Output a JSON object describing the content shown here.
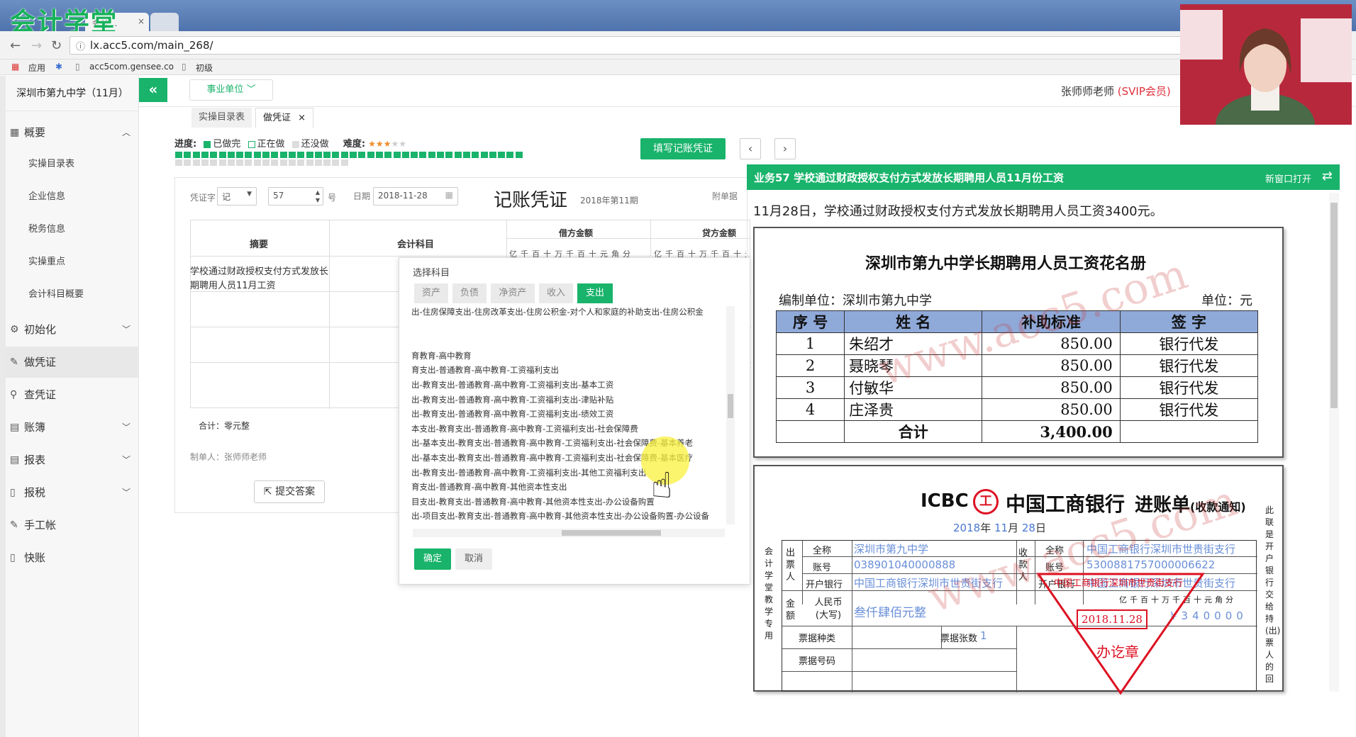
{
  "browser": {
    "logo_text": "会计学堂",
    "tab_label": "会计...",
    "url": "lx.acc5.com/main_268/",
    "bookmarks": [
      "应用",
      "acc5com.gensee.co",
      "初级"
    ]
  },
  "app": {
    "unit_select": "事业单位",
    "teacher": "张师师老师",
    "teacher_badge": "(SVIP会员)"
  },
  "sidebar": {
    "org": "深圳市第九中学（11月）",
    "sections": [
      {
        "label": "概要",
        "icon": "grid-icon"
      },
      {
        "label": "初始化",
        "icon": "gear-icon"
      },
      {
        "label": "做凭证",
        "icon": "pen-icon"
      },
      {
        "label": "查凭证",
        "icon": "search-icon"
      },
      {
        "label": "账簿",
        "icon": "book-icon"
      },
      {
        "label": "报表",
        "icon": "table-icon"
      },
      {
        "label": "报税",
        "icon": "doc-icon"
      },
      {
        "label": "手工帐",
        "icon": "pen-icon"
      },
      {
        "label": "快账",
        "icon": "doc-icon"
      }
    ],
    "sub_items": [
      "实操目录表",
      "企业信息",
      "税务信息",
      "实操重点",
      "会计科目概要"
    ]
  },
  "tabs": [
    "实操目录表",
    "做凭证"
  ],
  "progress": {
    "label": "进度:",
    "legend": [
      "已做完",
      "正在做",
      "还没做"
    ],
    "difficulty_label": "难度:",
    "difficulty": 3,
    "difficulty_max": 5,
    "done_cells": 36,
    "total_cells": 60
  },
  "toolbar": {
    "fill_voucher": "填写记账凭证",
    "prev": "‹",
    "next": "›"
  },
  "voucher": {
    "type_label": "凭证字",
    "type_value": "记",
    "number": "57",
    "number_suffix": "号",
    "date_label": "日期",
    "date_value": "2018-11-28",
    "title": "记账凭证",
    "period": "2018年第11期",
    "attach_label": "附单据",
    "col_summary": "摘要",
    "col_subject": "会计科目",
    "col_debit": "借方金额",
    "col_credit": "贷方金额",
    "digit_headers": "亿千百十万千百十元角分",
    "summary_text": "学校通过财政授权支付方式发放长期聘用人员11月工资",
    "total": "合计：零元整",
    "maker": "制单人：张师师老师",
    "submit": "提交答案"
  },
  "picker": {
    "title": "选择科目",
    "tabs": [
      "资产",
      "负债",
      "净资产",
      "收入",
      "支出"
    ],
    "active_tab": "支出",
    "rows": [
      "出-住房保障支出-住房改革支出-住房公积金-对个人和家庭的补助支出-住房公积金",
      "",
      "",
      "育教育-高中教育",
      "育支出-普通教育-高中教育-工资福利支出",
      "出-教育支出-普通教育-高中教育-工资福利支出-基本工资",
      "出-教育支出-普通教育-高中教育-工资福利支出-津贴补贴",
      "出-教育支出-普通教育-高中教育-工资福利支出-绩效工资",
      "本支出-教育支出-普通教育-高中教育-工资福利支出-社会保障费",
      "出-基本支出-教育支出-普通教育-高中教育-工资福利支出-社会保障费-基本养老",
      "出-基本支出-教育支出-普通教育-高中教育-工资福利支出-社会保障费-基本医疗",
      "出-教育支出-普通教育-高中教育-工资福利支出-其他工资福利支出",
      "育支出-普通教育-高中教育-其他资本性支出",
      "目支出-教育支出-普通教育-高中教育-其他资本性支出-办公设备购置",
      "出-项目支出-教育支出-普通教育-高中教育-其他资本性支出-办公设备购置-办公设备"
    ],
    "ok": "确定",
    "cancel": "取消"
  },
  "business": {
    "header": "业务57 学校通过财政授权支付方式发放长期聘用人员11月份工资",
    "new_window": "新窗口打开",
    "swap_icon": "⇄",
    "description": "11月28日，学校通过财政授权支付方式发放长期聘用人员工资3400元。"
  },
  "payroll": {
    "title": "深圳市第九中学长期聘用人员工资花名册",
    "unit_label": "编制单位：深圳市第九中学",
    "unit_right": "单位：元",
    "headers": [
      "序  号",
      "姓  名",
      "补助标准",
      "签  字"
    ],
    "rows": [
      [
        "1",
        "朱绍才",
        "850.00",
        "银行代发"
      ],
      [
        "2",
        "聂晓琴",
        "850.00",
        "银行代发"
      ],
      [
        "3",
        "付敏华",
        "850.00",
        "银行代发"
      ],
      [
        "4",
        "庄泽贵",
        "850.00",
        "银行代发"
      ]
    ],
    "total_label": "合计",
    "total_value": "3,400.00",
    "watermark": "www.acc5.com"
  },
  "bank": {
    "logo": "ICBC",
    "bank_name": "中国工商银行",
    "doc_title": "进账单",
    "doc_subtitle": "(收款通知)",
    "right_vertical": "此联是开户银行交给持(出)票人的回",
    "date_year": "2018",
    "date_month": "11",
    "date_day": "28",
    "date_sep_year": "年",
    "date_sep_month": "月",
    "date_sep_day": "日",
    "side_label": "会计学堂教学专用",
    "payer_label": "出票人",
    "payee_label": "收款人",
    "full_name": "全称",
    "account": "账号",
    "bank_label": "开户银行",
    "payer_name": "深圳市第九中学",
    "payer_account": "038901040000888",
    "payer_bank": "中国工商银行深圳市世贵街支行",
    "payee_name": "中国工商银行深圳市世贵街支行",
    "payee_account": "5300881757000006622",
    "payee_bank": "中国工商银行深圳市世贵街支行",
    "amount_label": "金额",
    "rmb_label": "人民币(大写)",
    "amount_words": "叁仟肆佰元整",
    "amount_digits": "¥340000",
    "digit_headers": "亿千百十万千百十元角分",
    "bill_type": "票据种类",
    "bill_count": "票据张数",
    "bill_count_value": "1",
    "bill_no": "票据号码",
    "stamp_date": "2018.11.28",
    "stamp_text": "办讫章",
    "stamp_bank": "中国工商银行深圳市世贵街支行"
  },
  "colors": {
    "accent": "#19b36b",
    "vip": "#e0303b",
    "table_header": "#8fa9d9",
    "stamp": "#d12222"
  }
}
